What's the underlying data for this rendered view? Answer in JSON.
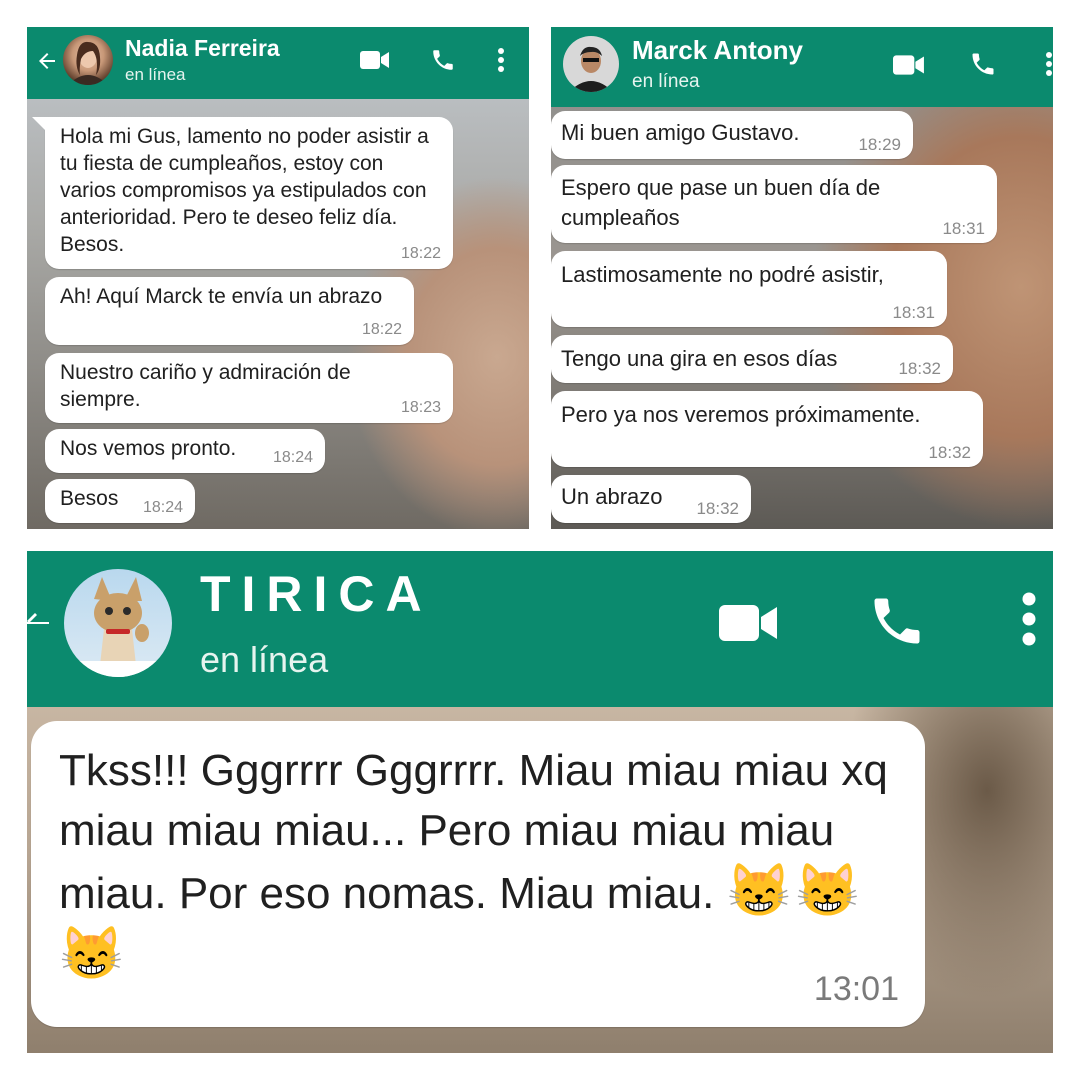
{
  "chats": [
    {
      "contact": {
        "name": "Nadia Ferreira",
        "status": "en línea"
      },
      "messages": [
        {
          "text": "Hola mi Gus, lamento no poder asistir a tu fiesta de cumpleaños, estoy con varios compromisos ya estipulados con anterioridad. Pero te deseo feliz día. Besos.",
          "time": "18:22"
        },
        {
          "text": "Ah! Aquí Marck te envía un abrazo",
          "time": "18:22"
        },
        {
          "text": "Nuestro cariño y admiración de siempre.",
          "time": "18:23"
        },
        {
          "text": "Nos vemos pronto.",
          "time": "18:24"
        },
        {
          "text": "Besos",
          "time": "18:24"
        }
      ]
    },
    {
      "contact": {
        "name": "Marck Antony",
        "status": "en línea"
      },
      "messages": [
        {
          "text": "Mi buen amigo Gustavo.",
          "time": "18:29"
        },
        {
          "text": "Espero que pase un buen día de cumpleaños",
          "time": "18:31"
        },
        {
          "text": "Lastimosamente no podré asistir,",
          "time": "18:31"
        },
        {
          "text": "Tengo una gira en esos días",
          "time": "18:32"
        },
        {
          "text": "Pero ya nos veremos próximamente.",
          "time": "18:32"
        },
        {
          "text": "Un abrazo",
          "time": "18:32"
        }
      ]
    },
    {
      "contact": {
        "name": "TIRICA",
        "status": "en línea"
      },
      "messages": [
        {
          "text": "Tkss!!! Gggrrrr Gggrrrr. Miau miau miau xq miau miau miau... Pero miau miau miau miau. Por eso nomas. Miau miau.",
          "emojis": "😸😸😸",
          "time": "13:01"
        }
      ]
    }
  ],
  "icons": [
    "back-arrow-icon",
    "video-call-icon",
    "phone-icon",
    "more-options-icon"
  ],
  "colors": {
    "header": "#0b8a6e",
    "bubble": "#ffffff",
    "timestamp": "#8a8a8a"
  }
}
